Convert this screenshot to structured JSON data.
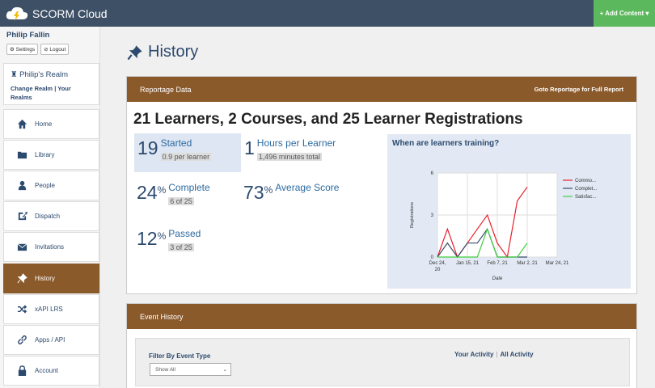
{
  "app": {
    "title": "SCORM Cloud",
    "add_content": "+ Add Content ▾"
  },
  "user": {
    "name": "Philip Fallin",
    "settings": "⚙ Settings",
    "logout": "⊘ Logout"
  },
  "realm": {
    "name": "Philip's Realm",
    "change": "Change Realm",
    "sep": " | ",
    "your": "Your",
    "realms": "Realms"
  },
  "nav": [
    {
      "label": "Home",
      "icon": "home-icon"
    },
    {
      "label": "Library",
      "icon": "folder-icon"
    },
    {
      "label": "People",
      "icon": "person-icon"
    },
    {
      "label": "Dispatch",
      "icon": "dispatch-icon"
    },
    {
      "label": "Invitations",
      "icon": "envelope-icon"
    },
    {
      "label": "History",
      "icon": "pin-icon",
      "active": true
    },
    {
      "label": "xAPI LRS",
      "icon": "shuffle-icon"
    },
    {
      "label": "Apps / API",
      "icon": "link-icon"
    },
    {
      "label": "Account",
      "icon": "lock-icon"
    }
  ],
  "page": {
    "title": "History"
  },
  "reportage": {
    "header": "Reportage Data",
    "link": "Goto Reportage for Full Report",
    "headline": "21 Learners, 2 Courses, and 25 Learner Registrations",
    "started": {
      "num": "19",
      "label": "Started",
      "sub": "0.9 per learner"
    },
    "hours": {
      "num": "1",
      "label": "Hours per Learner",
      "sub": "1,496 minutes total"
    },
    "complete": {
      "num": "24",
      "pct": "%",
      "label": "Complete",
      "sub": "6 of 25"
    },
    "score": {
      "num": "73",
      "pct": "%",
      "label": "Average Score"
    },
    "passed": {
      "num": "12",
      "pct": "%",
      "label": "Passed",
      "sub": "3 of 25"
    }
  },
  "chart_data": {
    "type": "line",
    "title": "When are learners training?",
    "xlabel": "Date",
    "ylabel": "Registrations",
    "ylim": [
      0,
      6
    ],
    "yticks": [
      "0",
      "3",
      "6"
    ],
    "x_tick_labels": [
      "Dec 24,\n20",
      "Jan 15, 21",
      "Feb 7, 21",
      "Mar 2, 21",
      "Mar 24, 21"
    ],
    "x": [
      0,
      1,
      2,
      3,
      4,
      5,
      6,
      7,
      8,
      9,
      10,
      11,
      12
    ],
    "series": [
      {
        "name": "Commo...",
        "color": "#e8202a",
        "values": [
          0,
          2,
          0,
          1,
          2,
          3,
          1,
          0,
          4,
          5
        ]
      },
      {
        "name": "Complet...",
        "color": "#3a4a6b",
        "values": [
          0,
          1,
          0,
          1,
          1,
          2,
          0,
          0,
          0,
          0
        ]
      },
      {
        "name": "Satisfac...",
        "color": "#3fcf3f",
        "values": [
          0,
          0,
          0,
          0,
          0,
          2,
          0,
          0,
          0,
          1
        ]
      }
    ]
  },
  "events": {
    "header": "Event History",
    "filter_label": "Filter By Event Type",
    "filter_value": "Show All",
    "your_activity": "Your Activity",
    "all_activity": "All Activity",
    "sep": "|"
  }
}
